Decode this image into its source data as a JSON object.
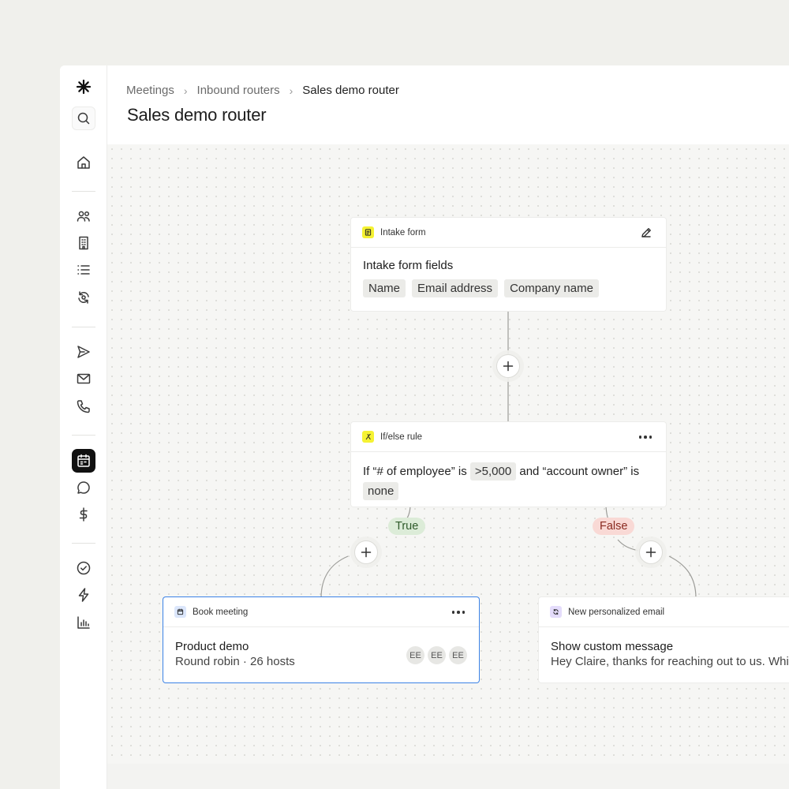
{
  "logo": "logo-asterisk",
  "breadcrumb": {
    "items": [
      "Meetings",
      "Inbound routers"
    ],
    "current": "Sales demo router",
    "separator": "›"
  },
  "page": {
    "title": "Sales demo router"
  },
  "sidebar": {
    "icons": [
      "search-icon",
      "home-icon",
      "people-icon",
      "building-icon",
      "list-icon",
      "sync-icon",
      "send-icon",
      "mail-icon",
      "phone-icon",
      "calendar-icon",
      "chat-icon",
      "dollar-icon",
      "check-circle-icon",
      "lightning-icon",
      "bar-chart-icon"
    ],
    "active": "calendar-icon"
  },
  "intake_card": {
    "type_label": "Intake form",
    "title": "Intake form fields",
    "fields": [
      "Name",
      "Email address",
      "Company name"
    ],
    "icon_color": "#f5f233",
    "action_icon": "pencil-icon"
  },
  "rule_card": {
    "type_label": "If/else rule",
    "text_1": "If “# of employee” is",
    "value_1": ">5,000",
    "text_2": "and “account owner” is",
    "value_2": "none",
    "icon_color": "#f5f233",
    "action_icon": "more-icon"
  },
  "branches": {
    "true_label": "True",
    "false_label": "False",
    "true_bg": "#dcecd8",
    "true_fg": "#2e5a2a",
    "false_bg": "#f9d9d5",
    "false_fg": "#8a2a20"
  },
  "book_card": {
    "type_label": "Book meeting",
    "title": "Product demo",
    "subtitle": "Round robin · 26 hosts",
    "avatars": [
      "EE",
      "EE",
      "EE"
    ],
    "icon_color": "#dbe6fb",
    "border_color": "#3b82e6",
    "action_icon": "more-icon"
  },
  "email_card": {
    "type_label": "New personalized email",
    "title": "Show custom message",
    "body": "Hey Claire, thanks for reaching out to us. While",
    "icon_color": "#e4dcfb"
  }
}
